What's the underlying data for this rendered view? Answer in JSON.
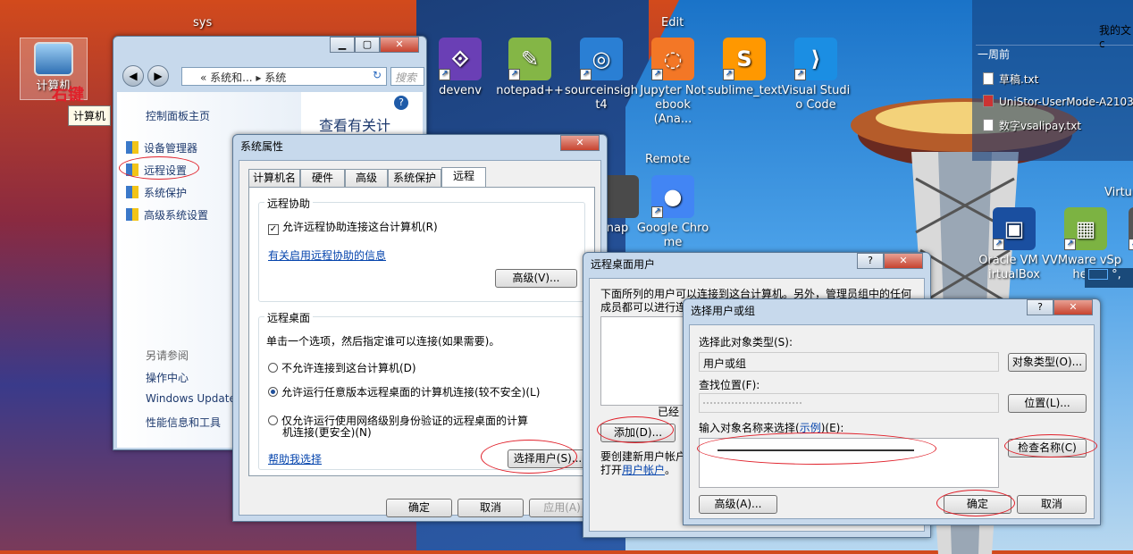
{
  "desktop": {
    "fences": {
      "sys": "sys",
      "edit": "Edit",
      "remote": "Remote",
      "virtual": "Virtu"
    },
    "computer_icon": {
      "label": "计算机",
      "annotation": "右键",
      "tooltip": "计算机"
    },
    "edit_icons": [
      {
        "name": "devenv",
        "label": "devenv",
        "color": "#6a3fb5",
        "glyph": "⟐"
      },
      {
        "name": "notepad++",
        "label": "notepad++",
        "color": "#84b646",
        "glyph": "✎"
      },
      {
        "name": "sourceinsight",
        "label": "sourceinsigh t4",
        "color": "#2a7fd4",
        "glyph": "◎"
      },
      {
        "name": "jupyter",
        "label": "Jupyter Not ebook (Ana...",
        "color": "#f37726",
        "glyph": "◌"
      },
      {
        "name": "sublime",
        "label": "sublime_text",
        "color": "#ff9800",
        "glyph": "S"
      },
      {
        "name": "vscode",
        "label": "Visual Studi o Code",
        "color": "#1b8ee3",
        "glyph": "⟩"
      }
    ],
    "remote_icons": [
      {
        "name": "snap",
        "label": "nap",
        "color": "#4a4a4a",
        "glyph": ""
      },
      {
        "name": "chrome",
        "label": "Google Chro me",
        "color": "#4285f4",
        "glyph": "●"
      }
    ],
    "virtual_icons": [
      {
        "name": "virtualbox",
        "label": "Oracle VM V irtualBox",
        "color": "#1a4fa0",
        "glyph": "▣"
      },
      {
        "name": "vmware",
        "label": "VMware vSp here",
        "color": "#7cb342",
        "glyph": "▦"
      },
      {
        "name": "i-partial",
        "label": "i",
        "color": "#555",
        "glyph": ""
      }
    ],
    "documents": {
      "header": "我的文c",
      "section": "一周前",
      "files": [
        "草稿.txt",
        "UniStor-UserMode-A2103",
        "数字vsalipay.txt"
      ]
    },
    "edge_text": "°,"
  },
  "control_panel": {
    "address": "« 系统和... ▸ 系统",
    "search_placeholder": "搜索",
    "home": "控制面板主页",
    "items": [
      "设备管理器",
      "远程设置",
      "系统保护",
      "高级系统设置"
    ],
    "see_also_title": "另请参阅",
    "see_also": [
      "操作中心",
      "Windows Update",
      "性能信息和工具"
    ],
    "heading": "查看有关计"
  },
  "sys_props": {
    "title": "系统属性",
    "tabs": [
      "计算机名",
      "硬件",
      "高级",
      "系统保护",
      "远程"
    ],
    "assist_group": "远程协助",
    "assist_check": "允许远程协助连接这台计算机(R)",
    "assist_link": "有关启用远程协助的信息",
    "advanced_btn": "高级(V)...",
    "desktop_group": "远程桌面",
    "desktop_desc": "单击一个选项，然后指定谁可以连接(如果需要)。",
    "opt1": "不允许连接到这台计算机(D)",
    "opt2": "允许运行任意版本远程桌面的计算机连接(较不安全)(L)",
    "opt3a": "仅允许运行使用网络级别身份验证的远程桌面的计算",
    "opt3b": "机连接(更安全)(N)",
    "help_link": "帮助我选择",
    "select_users_btn": "选择用户(S)...",
    "ok": "确定",
    "cancel": "取消",
    "apply": "应用(A)"
  },
  "rd_users": {
    "title": "远程桌面用户",
    "desc1": "下面所列的用户可以连接到这台计算机。另外，管理员组中的任何",
    "desc2": "成员都可以进行连",
    "already": "已经",
    "add_btn": "添加(D)...",
    "create1": "要创建新用户帐户",
    "create2a": "打开",
    "create2b": "用户帐户",
    "create2c": "。"
  },
  "select_users": {
    "title": "选择用户或组",
    "type_label": "选择此对象类型(S):",
    "type_value": "用户或组",
    "type_btn": "对象类型(O)...",
    "loc_label": "查找位置(F):",
    "loc_btn": "位置(L)...",
    "name_label_a": "输入对象名称来选择(",
    "name_label_link": "示例",
    "name_label_b": ")(E):",
    "check_btn": "检查名称(C)",
    "advanced_btn": "高级(A)...",
    "ok": "确定",
    "cancel": "取消"
  }
}
